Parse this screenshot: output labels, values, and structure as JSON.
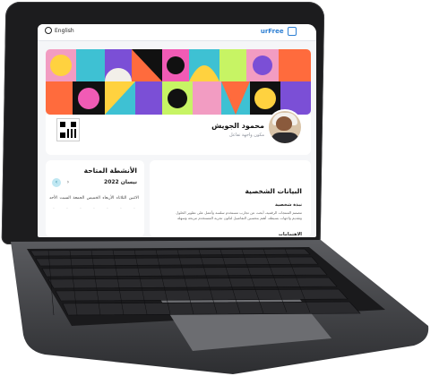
{
  "header": {
    "language_label": "English",
    "logo_text": "urFree"
  },
  "profile": {
    "name": "محمود الجويش",
    "subtitle": "مكون واجهة تفاعل"
  },
  "activities": {
    "title": "الأنشطة المتاحة",
    "month": "نيسان 2022",
    "prev_icon": "chevron-left-icon",
    "next_icon": "chevron-right-icon",
    "days": [
      "الاثنين",
      "الثلاثاء",
      "الأربعاء",
      "الخميس",
      "الجمعة",
      "السبت",
      "الأحد"
    ],
    "dates": [
      "",
      "",
      "",
      "",
      "",
      "",
      ""
    ]
  },
  "personal": {
    "title": "البيانات الشخصية",
    "about_heading": "نبذة شخصية",
    "about_text": "مصمم المنتجات الرقمية، أبحث عن تجارب مستخدم سلسة وأعمل على تطوير الحلول وتقديم واجهات بسيطة، أهتم بتحسين التفاصيل لتكون تجربة المستخدم مريحة وسهلة",
    "skills_heading": "الاهتمامات"
  },
  "colors": {
    "accent": "#2d7fd3",
    "chip": "#cfe9f2",
    "bezel": "#1c1c1e"
  }
}
